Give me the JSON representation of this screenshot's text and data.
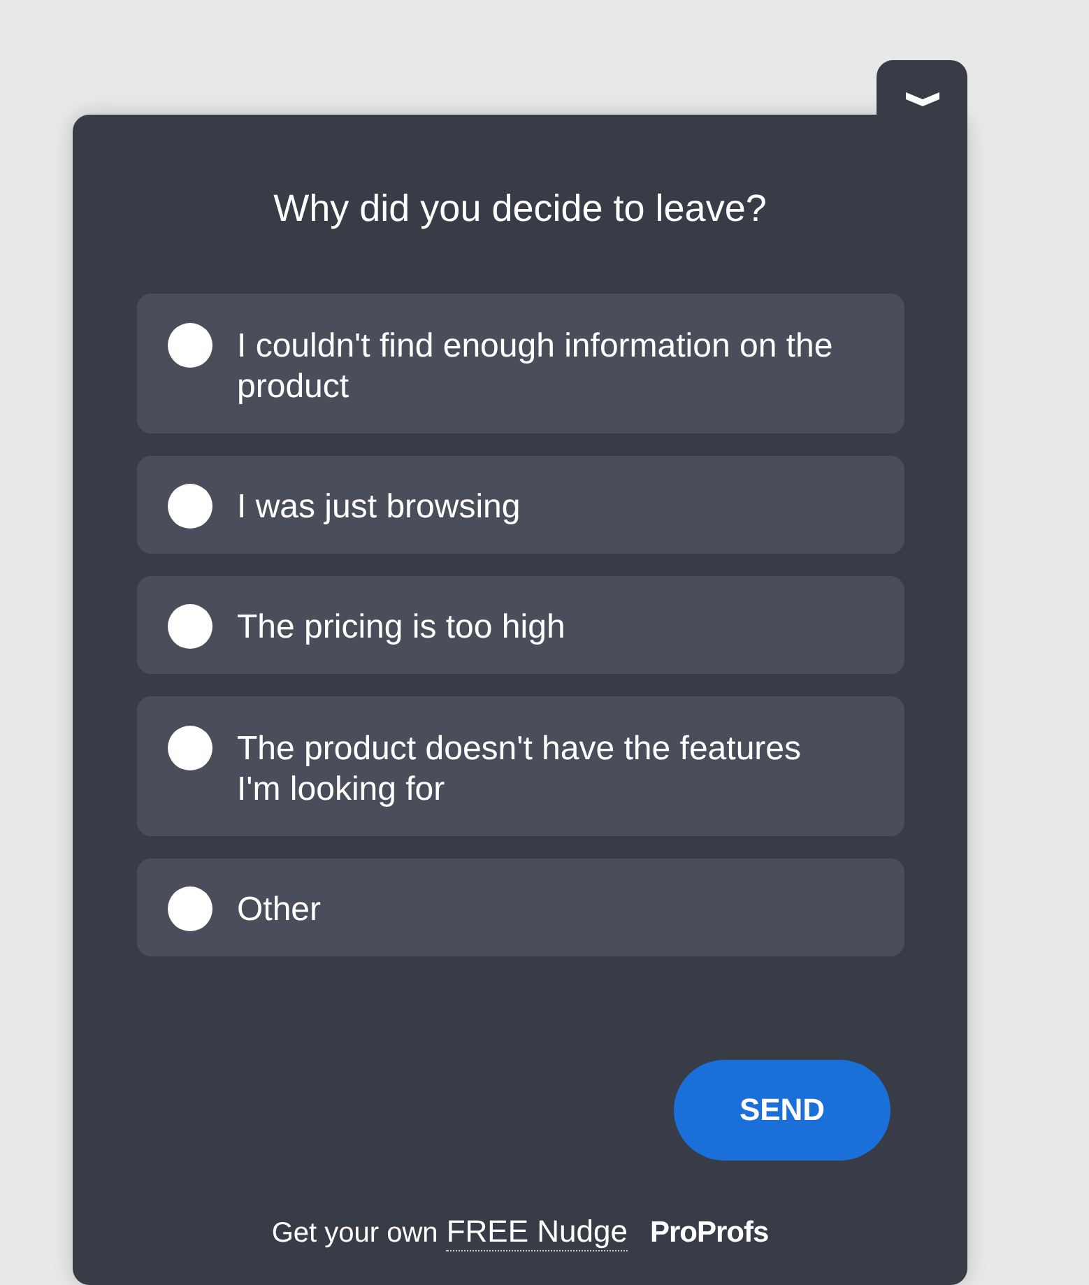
{
  "widget": {
    "title": "Why did you decide to leave?"
  },
  "options": [
    {
      "label": "I couldn't find enough information on the product",
      "selected": false
    },
    {
      "label": "I was just browsing",
      "selected": false
    },
    {
      "label": "The pricing is too high",
      "selected": false
    },
    {
      "label": "The product doesn't have the features I'm looking for",
      "selected": false
    },
    {
      "label": "Other",
      "selected": false
    }
  ],
  "send_button": "SEND",
  "footer": {
    "text": "Get your own",
    "link": "FREE Nudge",
    "brand": "ProProfs"
  }
}
